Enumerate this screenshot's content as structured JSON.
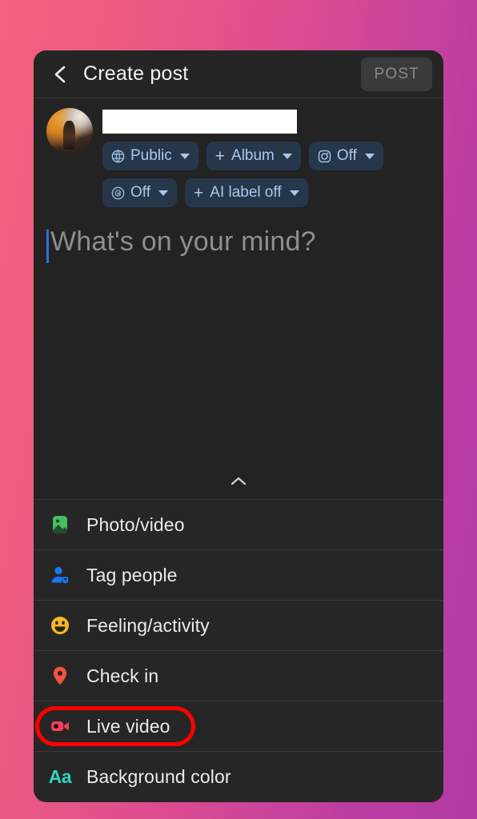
{
  "background": {
    "gradient_start": "#f4607f",
    "gradient_end": "#b23aa4"
  },
  "topbar": {
    "back_icon": "chevron-left-icon",
    "title": "Create post",
    "post_label": "POST",
    "post_enabled": false,
    "post_text_color": "#8b8b8b",
    "post_bg_color": "#3b3b3b"
  },
  "composer": {
    "avatar_alt": "profile-photo",
    "name_redacted": true,
    "chip_rows": [
      [
        {
          "icon": "globe-icon",
          "label": "Public",
          "has_plus": false,
          "has_caret": true
        },
        {
          "icon": "plus-icon",
          "label": "Album",
          "has_plus": true,
          "has_caret": true
        },
        {
          "icon": "instagram-icon",
          "label": "Off",
          "has_plus": false,
          "has_caret": true
        }
      ],
      [
        {
          "icon": "threads-icon",
          "label": "Off",
          "has_plus": false,
          "has_caret": true
        },
        {
          "icon": "plus-icon",
          "label": "AI label off",
          "has_plus": true,
          "has_caret": true
        }
      ]
    ],
    "chip_bg_color": "#27374b",
    "chip_text_color": "#a8c8ec",
    "placeholder": "What's on your mind?",
    "text_value": "",
    "cursor_color": "#2f72d8",
    "collapse_icon": "chevron-up-icon"
  },
  "options": {
    "items": [
      {
        "icon": "photo-video-icon",
        "label": "Photo/video",
        "icon_color": "#45bd62",
        "highlighted": false
      },
      {
        "icon": "tag-people-icon",
        "label": "Tag people",
        "icon_color": "#1877f2",
        "highlighted": false
      },
      {
        "icon": "feeling-activity-icon",
        "label": "Feeling/activity",
        "icon_color": "#f7b928",
        "highlighted": false
      },
      {
        "icon": "location-pin-icon",
        "label": "Check in",
        "icon_color": "#f5533d",
        "highlighted": false
      },
      {
        "icon": "live-video-icon",
        "label": "Live video",
        "icon_color": "#f3425f",
        "highlighted": true
      },
      {
        "icon": "background-color-icon",
        "label": "Background color",
        "icon_color": "#2fd6bb",
        "highlighted": false
      }
    ],
    "highlight_color": "#ff0000"
  }
}
